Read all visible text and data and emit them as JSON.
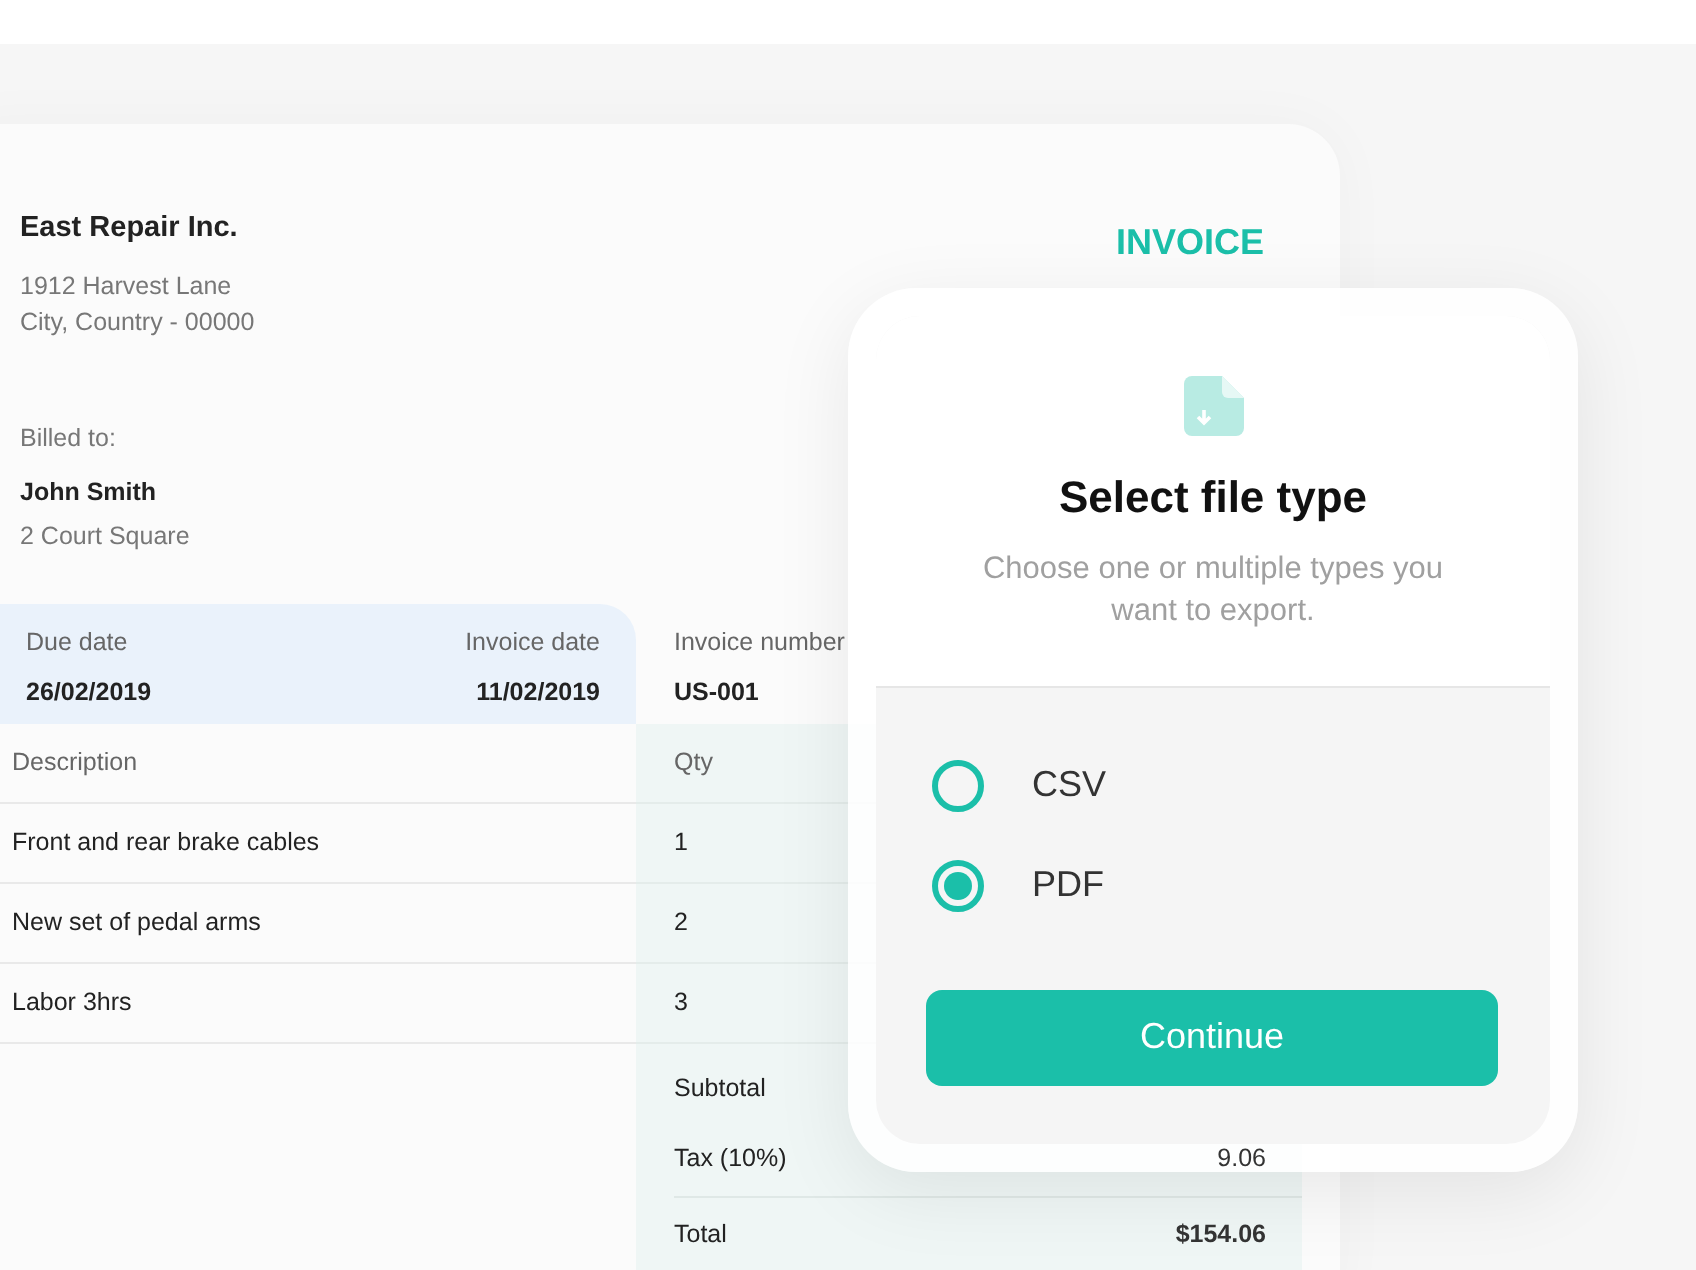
{
  "company": {
    "name": "East Repair Inc.",
    "address_lines": [
      "1912 Harvest Lane",
      "City, Country - 00000"
    ]
  },
  "document_title": "INVOICE",
  "billed_to": {
    "label": "Billed to:",
    "name": "John Smith",
    "address": "2 Court Square"
  },
  "dates": [
    {
      "label": "Due date",
      "value": "26/02/2019"
    },
    {
      "label": "Invoice date",
      "value": "11/02/2019"
    },
    {
      "label": "Invoice number",
      "value": "US-001"
    }
  ],
  "table": {
    "columns": [
      "Description",
      "Qty"
    ],
    "rows": [
      {
        "description": "Front and rear brake cables",
        "qty": "1"
      },
      {
        "description": "New set of pedal arms",
        "qty": "2"
      },
      {
        "description": "Labor 3hrs",
        "qty": "3"
      }
    ]
  },
  "totals": [
    {
      "label": "Subtotal"
    },
    {
      "label": "Tax (10%)",
      "value": "9.06"
    },
    {
      "label": "Total",
      "value": "$154.06",
      "kind": "grand"
    }
  ],
  "export_dialog": {
    "title": "Select file type",
    "subtitle": "Choose one or multiple types you want to export.",
    "options": [
      {
        "label": "CSV",
        "selected": false
      },
      {
        "label": "PDF",
        "selected": true
      }
    ],
    "button": "Continue"
  }
}
